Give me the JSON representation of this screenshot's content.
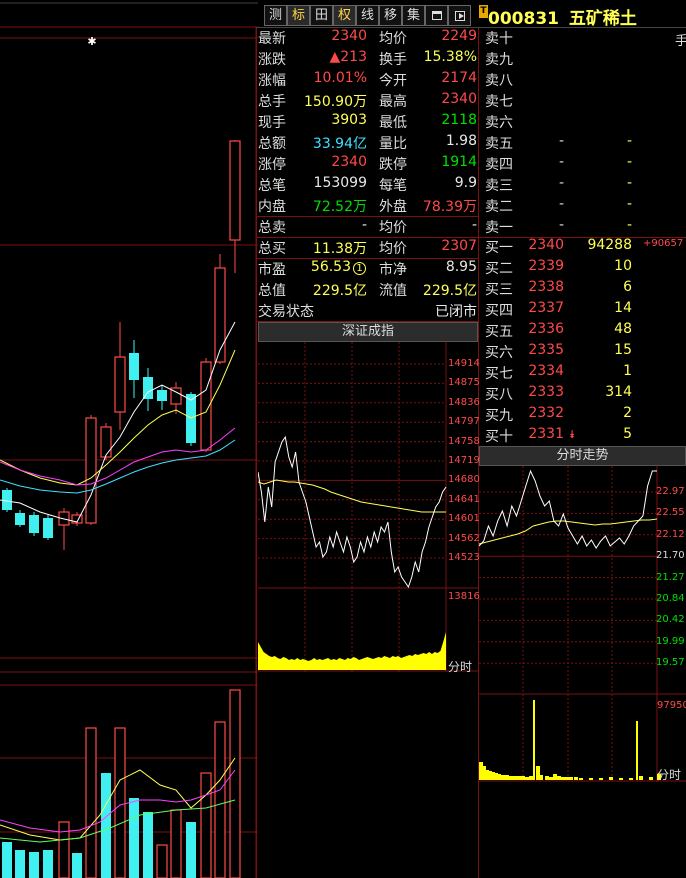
{
  "toolbar": {
    "tabs": [
      {
        "label": "测",
        "active": false
      },
      {
        "label": "标",
        "active": true
      },
      {
        "label": "田",
        "active": false
      },
      {
        "label": "权",
        "active": true
      },
      {
        "label": "线",
        "active": false
      },
      {
        "label": "移",
        "active": false
      },
      {
        "label": "集",
        "active": false
      },
      {
        "label": "",
        "icon": "window-icon"
      },
      {
        "label": "",
        "icon": "play-icon"
      }
    ]
  },
  "stock": {
    "badge": "T",
    "code": "000831",
    "name": "五矿稀土",
    "unit_label": "手"
  },
  "quote": {
    "rows": [
      {
        "l1": "最新",
        "v1": "2340",
        "c1": "red",
        "l2": "均价",
        "v2": "2249",
        "c2": "red"
      },
      {
        "l1": "涨跌",
        "v1": "▲213",
        "c1": "red",
        "l2": "换手",
        "v2": "15.38%",
        "c2": "yel"
      },
      {
        "l1": "涨幅",
        "v1": "10.01%",
        "c1": "red",
        "l2": "今开",
        "v2": "2174",
        "c2": "red"
      },
      {
        "l1": "总手",
        "v1": "150.90万",
        "c1": "yel",
        "l2": "最高",
        "v2": "2340",
        "c2": "red"
      },
      {
        "l1": "现手",
        "v1": "3903",
        "c1": "yel",
        "l2": "最低",
        "v2": "2118",
        "c2": "grn"
      },
      {
        "l1": "总额",
        "v1": "33.94亿",
        "c1": "cyn",
        "l2": "量比",
        "v2": "1.98",
        "c2": "wht"
      },
      {
        "l1": "涨停",
        "v1": "2340",
        "c1": "red",
        "l2": "跌停",
        "v2": "1914",
        "c2": "grn"
      },
      {
        "l1": "总笔",
        "v1": "153099",
        "c1": "wht",
        "l2": "每笔",
        "v2": "9.9",
        "c2": "wht"
      },
      {
        "l1": "内盘",
        "v1": "72.52万",
        "c1": "grn",
        "l2": "外盘",
        "v2": "78.39万",
        "c2": "red"
      },
      {
        "l1": "总卖",
        "v1": "-",
        "c1": "wht",
        "l2": "均价",
        "v2": "-",
        "c2": "wht"
      },
      {
        "l1": "总买",
        "v1": "11.38万",
        "c1": "yel",
        "l2": "均价",
        "v2": "2307",
        "c2": "red"
      },
      {
        "l1": "市盈",
        "v1": "56.53",
        "c1": "yel",
        "l2": "市净",
        "v2": "8.95",
        "c2": "wht"
      },
      {
        "l1": "总值",
        "v1": "229.5亿",
        "c1": "yel",
        "l2": "流值",
        "v2": "229.5亿",
        "c2": "yel"
      },
      {
        "l1": "交易状态",
        "v1": "",
        "c1": "wht",
        "l2": "",
        "v2": "已闭市",
        "c2": "wht"
      }
    ],
    "pe_marker": "1"
  },
  "orderbook": {
    "asks": [
      {
        "name": "卖十",
        "price": "",
        "vol": ""
      },
      {
        "name": "卖九",
        "price": "",
        "vol": ""
      },
      {
        "name": "卖八",
        "price": "",
        "vol": ""
      },
      {
        "name": "卖七",
        "price": "",
        "vol": ""
      },
      {
        "name": "卖六",
        "price": "",
        "vol": ""
      },
      {
        "name": "卖五",
        "price": "-",
        "vol": "-"
      },
      {
        "name": "卖四",
        "price": "-",
        "vol": "-"
      },
      {
        "name": "卖三",
        "price": "-",
        "vol": "-"
      },
      {
        "name": "卖二",
        "price": "-",
        "vol": "-"
      },
      {
        "name": "卖一",
        "price": "-",
        "vol": "-"
      }
    ],
    "bids": [
      {
        "name": "买一",
        "price": "2340",
        "vol": "94288"
      },
      {
        "name": "买二",
        "price": "2339",
        "vol": "10"
      },
      {
        "name": "买三",
        "price": "2338",
        "vol": "6"
      },
      {
        "name": "买四",
        "price": "2337",
        "vol": "14"
      },
      {
        "name": "买五",
        "price": "2336",
        "vol": "48"
      },
      {
        "name": "买六",
        "price": "2335",
        "vol": "15"
      },
      {
        "name": "买七",
        "price": "2334",
        "vol": "1"
      },
      {
        "name": "买八",
        "price": "2333",
        "vol": "314"
      },
      {
        "name": "买九",
        "price": "2332",
        "vol": "2"
      },
      {
        "name": "买十",
        "price": "2331",
        "vol": "5"
      }
    ],
    "bid1_change": "+90657"
  },
  "index_panel": {
    "title": "深证成指",
    "price_axis": [
      "14914",
      "14875",
      "14836",
      "14797",
      "14758",
      "14719",
      "14680",
      "14641",
      "14601",
      "14562",
      "14523"
    ],
    "volume_axis": "13816",
    "time_label": "分时"
  },
  "intraday_panel": {
    "title": "分时走势",
    "price_axis": [
      "22.97",
      "22.55",
      "22.12",
      "21.70",
      "21.27",
      "20.84",
      "20.42",
      "19.99",
      "19.57"
    ],
    "volume_axis": "97950",
    "time_label": "分时"
  },
  "colors": {
    "up": "#ff4a4a",
    "down": "#40f0f0",
    "grid": "#7a1010",
    "ma5": "#ffffff",
    "ma10": "#ffff55",
    "ma20": "#ff40ff",
    "ma60": "#40e0ff"
  }
}
